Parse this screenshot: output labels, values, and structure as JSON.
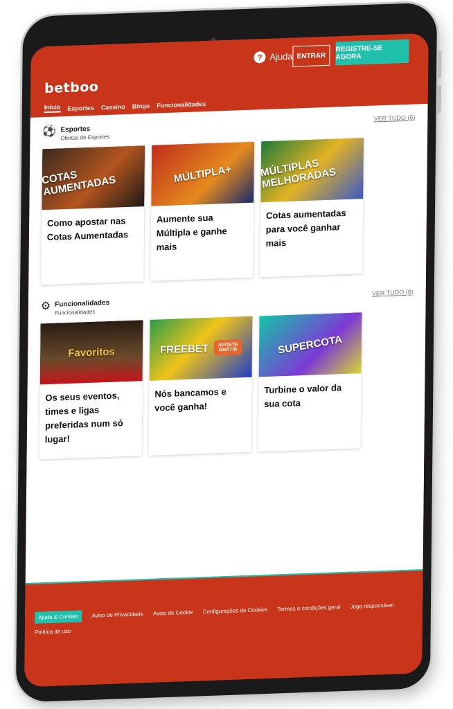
{
  "header": {
    "help_label": "Ajuda",
    "login_label": "ENTRAR",
    "register_label": "REGISTRE-SE AGORA",
    "logo_text": "betboo"
  },
  "nav": {
    "items": [
      {
        "label": "Início",
        "active": true
      },
      {
        "label": "Esportes"
      },
      {
        "label": "Cassino"
      },
      {
        "label": "Bingo"
      },
      {
        "label": "Funcionalidades"
      }
    ]
  },
  "sections": [
    {
      "title": "Esportes",
      "subtitle": "Ofertas de Esportes",
      "see_all": "VER TUDO (5)",
      "cards": [
        {
          "image_text": "COTAS AUMENTADAS",
          "text": "Como apostar nas Cotas Aumentadas"
        },
        {
          "image_text": "MÚLTIPLA+",
          "text": "Aumente sua Múltipla e ganhe mais"
        },
        {
          "image_text": "MÚLTIPLAS MELHORADAS",
          "text": "Cotas aumentadas para você ganhar mais"
        }
      ]
    },
    {
      "title": "Funcionalidades",
      "subtitle": "Funcionalidades",
      "see_all": "VER TUDO (8)",
      "cards": [
        {
          "image_text": "Favoritos",
          "text": "Os seus eventos, times e ligas preferidas num só lugar!"
        },
        {
          "image_text": "FREEBET",
          "image_badge": "APOSTA GRÁTIS",
          "text": "Nós bancamos e você ganha!"
        },
        {
          "image_text": "SUPERCOTA",
          "text": "Turbine o valor da sua cota"
        }
      ]
    }
  ],
  "footer": {
    "links": [
      "Ajuda & Contato",
      "Aviso de Privacidade",
      "Aviso de Cookie",
      "Configurações de Cookies",
      "Termos e condições geral",
      "Jogo responsável",
      "Política de uso"
    ]
  },
  "colors": {
    "brand_red": "#c8351a",
    "accent_teal": "#20c0ad"
  }
}
